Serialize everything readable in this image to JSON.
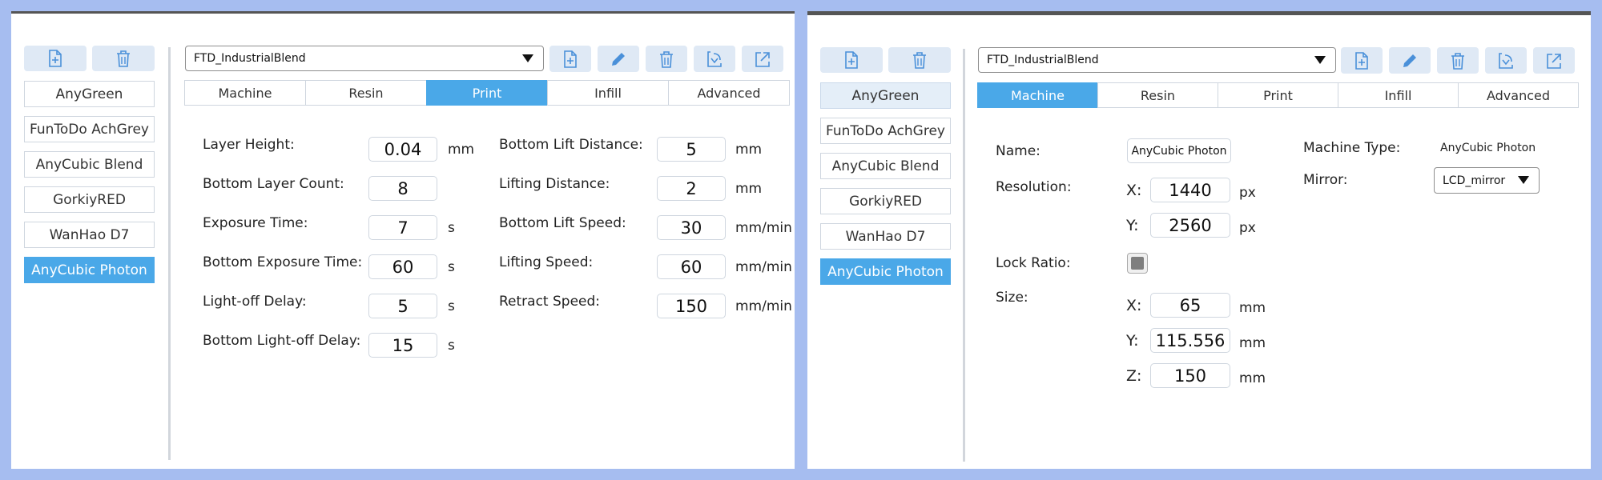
{
  "left": {
    "profiles": [
      "AnyGreen",
      "FunToDo AchGrey",
      "AnyCubic Blend",
      "GorkiyRED",
      "WanHao D7",
      "AnyCubic Photon"
    ],
    "selected_profile": "AnyCubic Photon",
    "combo_value": "FTD_IndustrialBlend",
    "tabs": [
      "Machine",
      "Resin",
      "Print",
      "Infill",
      "Advanced"
    ],
    "active_tab": "Print",
    "print_left": [
      {
        "label": "Layer Height:",
        "value": "0.04",
        "unit": "mm"
      },
      {
        "label": "Bottom Layer Count:",
        "value": "8",
        "unit": ""
      },
      {
        "label": "Exposure Time:",
        "value": "7",
        "unit": "s"
      },
      {
        "label": "Bottom Exposure Time:",
        "value": "60",
        "unit": "s"
      },
      {
        "label": "Light-off Delay:",
        "value": "5",
        "unit": "s"
      },
      {
        "label": "Bottom Light-off Delay:",
        "value": "15",
        "unit": "s"
      }
    ],
    "print_right": [
      {
        "label": "Bottom Lift Distance:",
        "value": "5",
        "unit": "mm"
      },
      {
        "label": "Lifting Distance:",
        "value": "2",
        "unit": "mm"
      },
      {
        "label": "Bottom Lift Speed:",
        "value": "30",
        "unit": "mm/min"
      },
      {
        "label": "Lifting Speed:",
        "value": "60",
        "unit": "mm/min"
      },
      {
        "label": "Retract Speed:",
        "value": "150",
        "unit": "mm/min"
      }
    ]
  },
  "right": {
    "profiles": [
      "AnyGreen",
      "FunToDo AchGrey",
      "AnyCubic Blend",
      "GorkiyRED",
      "WanHao D7",
      "AnyCubic Photon"
    ],
    "selected_profile": "AnyCubic Photon",
    "combo_value": "FTD_IndustrialBlend",
    "tabs": [
      "Machine",
      "Resin",
      "Print",
      "Infill",
      "Advanced"
    ],
    "active_tab": "Machine",
    "machine": {
      "name_label": "Name:",
      "name_value": "AnyCubic Photon",
      "resolution_label": "Resolution:",
      "res_x_axis": "X:",
      "res_x": "1440",
      "res_x_unit": "px",
      "res_y_axis": "Y:",
      "res_y": "2560",
      "res_y_unit": "px",
      "lock_label": "Lock Ratio:",
      "lock_checked": true,
      "size_label": "Size:",
      "size_x_axis": "X:",
      "size_x": "65",
      "size_x_unit": "mm",
      "size_y_axis": "Y:",
      "size_y": "115.556",
      "size_y_unit": "mm",
      "size_z_axis": "Z:",
      "size_z": "150",
      "size_z_unit": "mm",
      "type_label": "Machine Type:",
      "type_value": "AnyCubic Photon",
      "mirror_label": "Mirror:",
      "mirror_value": "LCD_mirror"
    }
  },
  "colors": {
    "accent": "#4aa8e8",
    "background": "#a6bdf0",
    "tool_bg": "#dfe9f5",
    "icon": "#4a90d9"
  },
  "icons": [
    "add-file-icon",
    "trash-icon",
    "pencil-icon",
    "import-icon",
    "export-icon",
    "dropdown-arrow-icon"
  ]
}
